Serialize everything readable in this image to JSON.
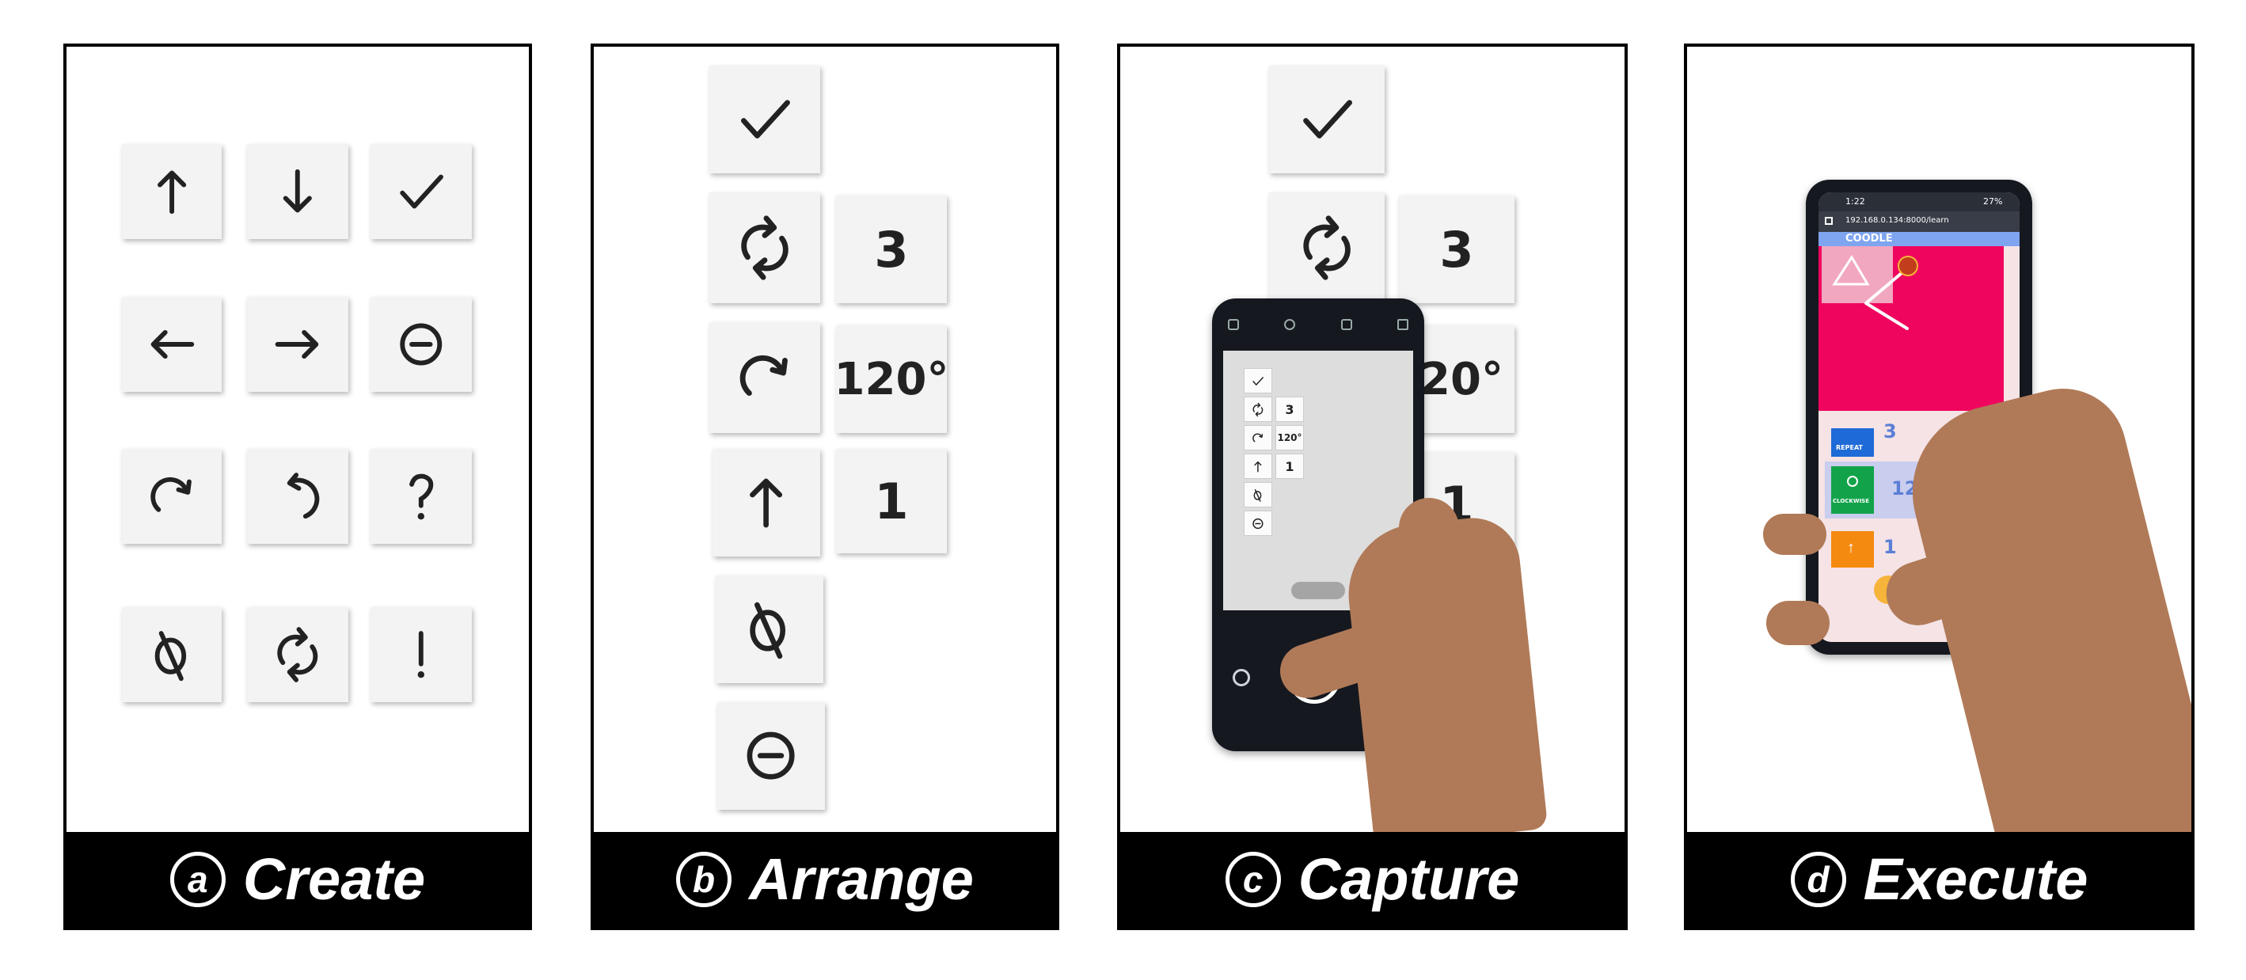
{
  "panels": [
    {
      "letter": "a",
      "caption": "Create"
    },
    {
      "letter": "b",
      "caption": "Arrange"
    },
    {
      "letter": "c",
      "caption": "Capture"
    },
    {
      "letter": "d",
      "caption": "Execute"
    }
  ],
  "arrange_values": {
    "repeat": "3",
    "angle": "120°",
    "steps": "1"
  },
  "capture_values": {
    "repeat": "3",
    "angle": "120°",
    "steps": "1"
  },
  "phone_app": {
    "time": "1:22",
    "battery": "27%",
    "url": "192.168.0.134:8000/learn",
    "app_name": "COODLE",
    "repeat_label": "REPEAT",
    "repeat_value": "3",
    "clockwise_label": "CLOCKWISE",
    "clockwise_value": "120",
    "forward_value": "1"
  },
  "colors": {
    "canvas": "#f0055e",
    "app_bg": "#f5e3e6",
    "repeat_blue": "#1e6ad6",
    "clockwise_green": "#12a34a",
    "forward_orange": "#f58a10",
    "number_blue": "#5c7fd6"
  }
}
